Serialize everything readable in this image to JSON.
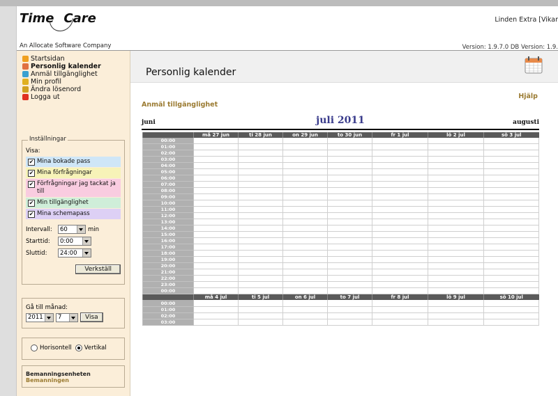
{
  "header": {
    "logo_left": "Time",
    "logo_right": "Care",
    "company": "An Allocate Software Company",
    "user": "Linden Extra [Vikar",
    "version": "Version: 1.9.7.0  DB Version: 1.9."
  },
  "nav": [
    {
      "label": "Startsidan",
      "icon": "info-icon",
      "bold": false
    },
    {
      "label": "Personlig kalender",
      "icon": "calendar-icon",
      "bold": true
    },
    {
      "label": "Anmäl tillgänglighet",
      "icon": "globe-icon",
      "bold": false
    },
    {
      "label": "Min profil",
      "icon": "person-icon",
      "bold": false
    },
    {
      "label": "Ändra lösenord",
      "icon": "lock-icon",
      "bold": false
    },
    {
      "label": "Logga ut",
      "icon": "power-icon",
      "bold": false
    }
  ],
  "settings": {
    "legend": "Inställningar",
    "show_label": "Visa:",
    "checks": [
      {
        "label": "Mina bokade pass",
        "color": "#cfe6f7"
      },
      {
        "label": "Mina förfrågningar",
        "color": "#f7f3b8"
      },
      {
        "label": "Förfrågningar jag tackat ja till",
        "color": "#f9cce0"
      },
      {
        "label": "Min tillgänglighet",
        "color": "#cfeed9"
      },
      {
        "label": "Mina schemapass",
        "color": "#ddd0f5"
      }
    ],
    "interval_label": "Intervall:",
    "interval_value": "60",
    "interval_unit": "min",
    "start_label": "Starttid:",
    "start_value": "0:00",
    "end_label": "Sluttid:",
    "end_value": "24:00",
    "apply": "Verkställ"
  },
  "goto": {
    "label": "Gå till månad:",
    "year": "2011",
    "month": "7",
    "button": "Visa"
  },
  "orientation": {
    "horizontal": "Horisontell",
    "vertical": "Vertikal",
    "selected": "Vertikal"
  },
  "unit": {
    "name": "Bemanningsenheten",
    "sub": "Bemanningen"
  },
  "main": {
    "title": "Personlig kalender",
    "help": "Hjälp",
    "subtitle": "Anmäl tillgänglighet",
    "prev_month": "juni",
    "current_month": "juli 2011",
    "next_month": "augusti"
  },
  "weeks": [
    {
      "days": [
        "må 27 jun",
        "ti 28 jun",
        "on 29 jun",
        "to 30 jun",
        "fr 1 jul",
        "lö 2 jul",
        "sö 3 jul"
      ],
      "times": [
        "00:00",
        "01:00",
        "02:00",
        "03:00",
        "04:00",
        "05:00",
        "06:00",
        "07:00",
        "08:00",
        "09:00",
        "10:00",
        "11:00",
        "12:00",
        "13:00",
        "14:00",
        "15:00",
        "16:00",
        "17:00",
        "18:00",
        "19:00",
        "20:00",
        "21:00",
        "22:00",
        "23:00",
        "00:00"
      ]
    },
    {
      "days": [
        "må 4 jul",
        "ti 5 jul",
        "on 6 jul",
        "to 7 jul",
        "fr 8 jul",
        "lö 9 jul",
        "sö 10 jul"
      ],
      "times": [
        "00:00",
        "01:00",
        "02:00",
        "03:00"
      ]
    }
  ]
}
